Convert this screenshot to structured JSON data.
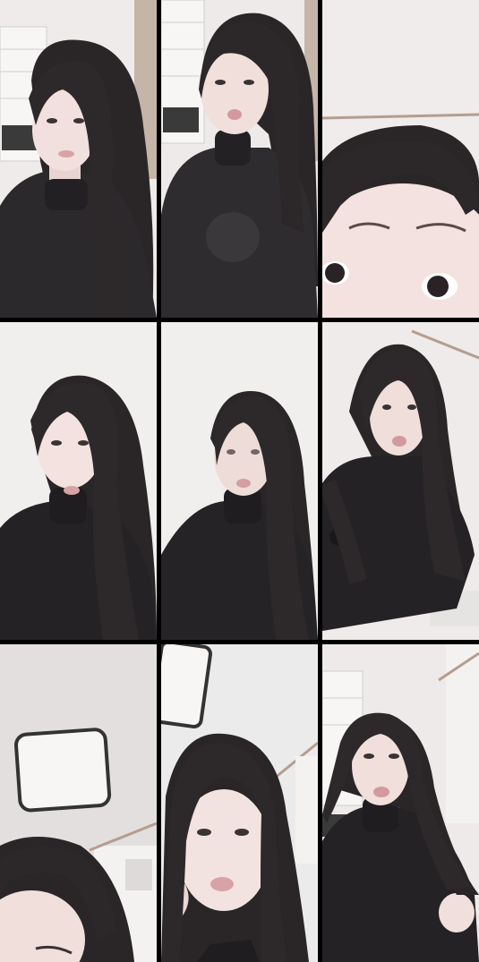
{
  "grid": {
    "columns": 3,
    "rows": 3
  },
  "colors": {
    "divider": "#000000",
    "wall": "#eeeaea",
    "hair": "#2a2628",
    "sweater": "#232123",
    "skin": "#f1dedd",
    "lips": "#d8a3a6"
  },
  "tiles": [
    {
      "subject": "person",
      "scene": "room-with-shelves"
    },
    {
      "subject": "person",
      "scene": "room-with-shelves"
    },
    {
      "subject": "person",
      "scene": "close-up-eyes"
    },
    {
      "subject": "person",
      "scene": "plain-wall"
    },
    {
      "subject": "person",
      "scene": "plain-wall"
    },
    {
      "subject": "person",
      "scene": "room-corner"
    },
    {
      "subject": "person",
      "scene": "ceiling-light"
    },
    {
      "subject": "person",
      "scene": "ceiling-light"
    },
    {
      "subject": "person",
      "scene": "room-with-shelves"
    }
  ]
}
